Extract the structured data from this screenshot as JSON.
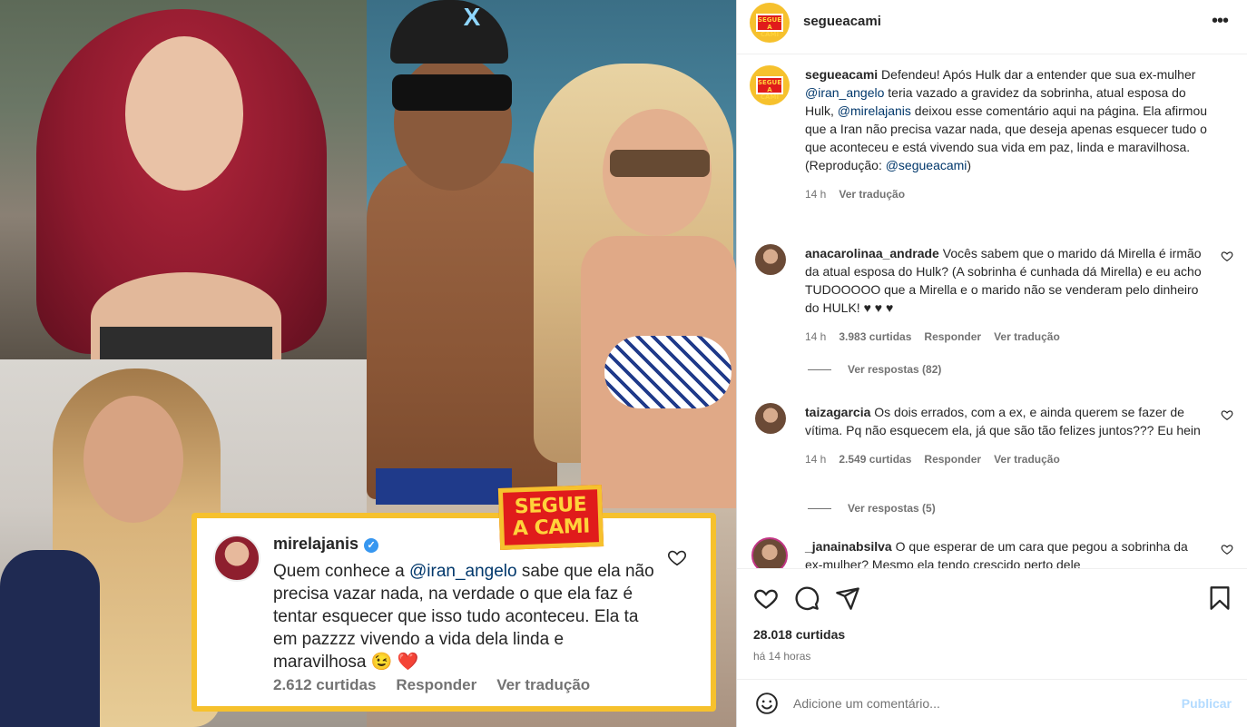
{
  "post": {
    "username": "segueacami",
    "brand_badge": "SEGUE A CAMI",
    "caption": {
      "username": "segueacami",
      "before_mention1": " Defendeu! Após Hulk dar a entender que sua ex-mulher ",
      "mention1": "@iran_angelo",
      "between": " teria vazado a gravidez da sobrinha, atual esposa do Hulk, ",
      "mention2": "@mirelajanis",
      "after_mention2": " deixou esse comentário aqui na página. Ela afirmou que a Iran não precisa vazar nada, que deseja apenas esquecer tudo o que aconteceu e está vivendo sua vida em paz, linda e maravilhosa.",
      "repro_prefix": "(Reprodução: ",
      "repro_mention": "@segueacami",
      "repro_suffix": ")",
      "time": "14 h",
      "translate": "Ver tradução"
    },
    "likes": "28.018 curtidas",
    "time_ago": "há 14 horas",
    "add_comment_placeholder": "Adicione um comentário...",
    "publish_label": "Publicar"
  },
  "overlay": {
    "username": "mirelajanis",
    "text_before": "Quem conhece a ",
    "mention": "@iran_angelo",
    "text_after": " sabe que ela não precisa vazar nada, na verdade o que ela faz é tentar esquecer que isso tudo aconteceu. Ela ta em pazzzz vivendo a vida dela linda e maravilhosa 😉 ❤️",
    "likes": "2.612 curtidas",
    "reply": "Responder",
    "translate": "Ver tradução"
  },
  "comments": [
    {
      "username": "anacarolinaa_andrade",
      "text": "Vocês sabem que o marido dá Mirella é irmão da atual esposa do Hulk? (A sobrinha é cunhada dá Mirella) e eu acho TUDOOOOO que a Mirella e o marido não se venderam pelo dinheiro do HULK! ♥ ♥ ♥",
      "time": "14 h",
      "likes": "3.983 curtidas",
      "reply": "Responder",
      "translate": "Ver tradução",
      "view_replies": "Ver respostas (82)"
    },
    {
      "username": "taizagarcia",
      "text": "Os dois errados, com a ex, e ainda querem se fazer de vítima. Pq não esquecem ela, já que são tão felizes juntos??? Eu hein",
      "time": "14 h",
      "likes": "2.549 curtidas",
      "reply": "Responder",
      "translate": "Ver tradução",
      "view_replies": "Ver respostas (5)"
    },
    {
      "username": "_janainabsilva",
      "text": "O que esperar de um cara que pegou a sobrinha da ex-mulher? Mesmo ela tendo crescido perto dele"
    }
  ],
  "icons": {
    "more": "more-options-icon",
    "heart": "heart-icon",
    "comment": "comment-icon",
    "share": "share-icon",
    "save": "bookmark-icon",
    "emoji": "emoji-icon"
  },
  "colors": {
    "brand_yellow": "#f6c12d",
    "brand_red": "#e01b1b",
    "link": "#00376b",
    "publish_disabled": "#b3dbff"
  }
}
